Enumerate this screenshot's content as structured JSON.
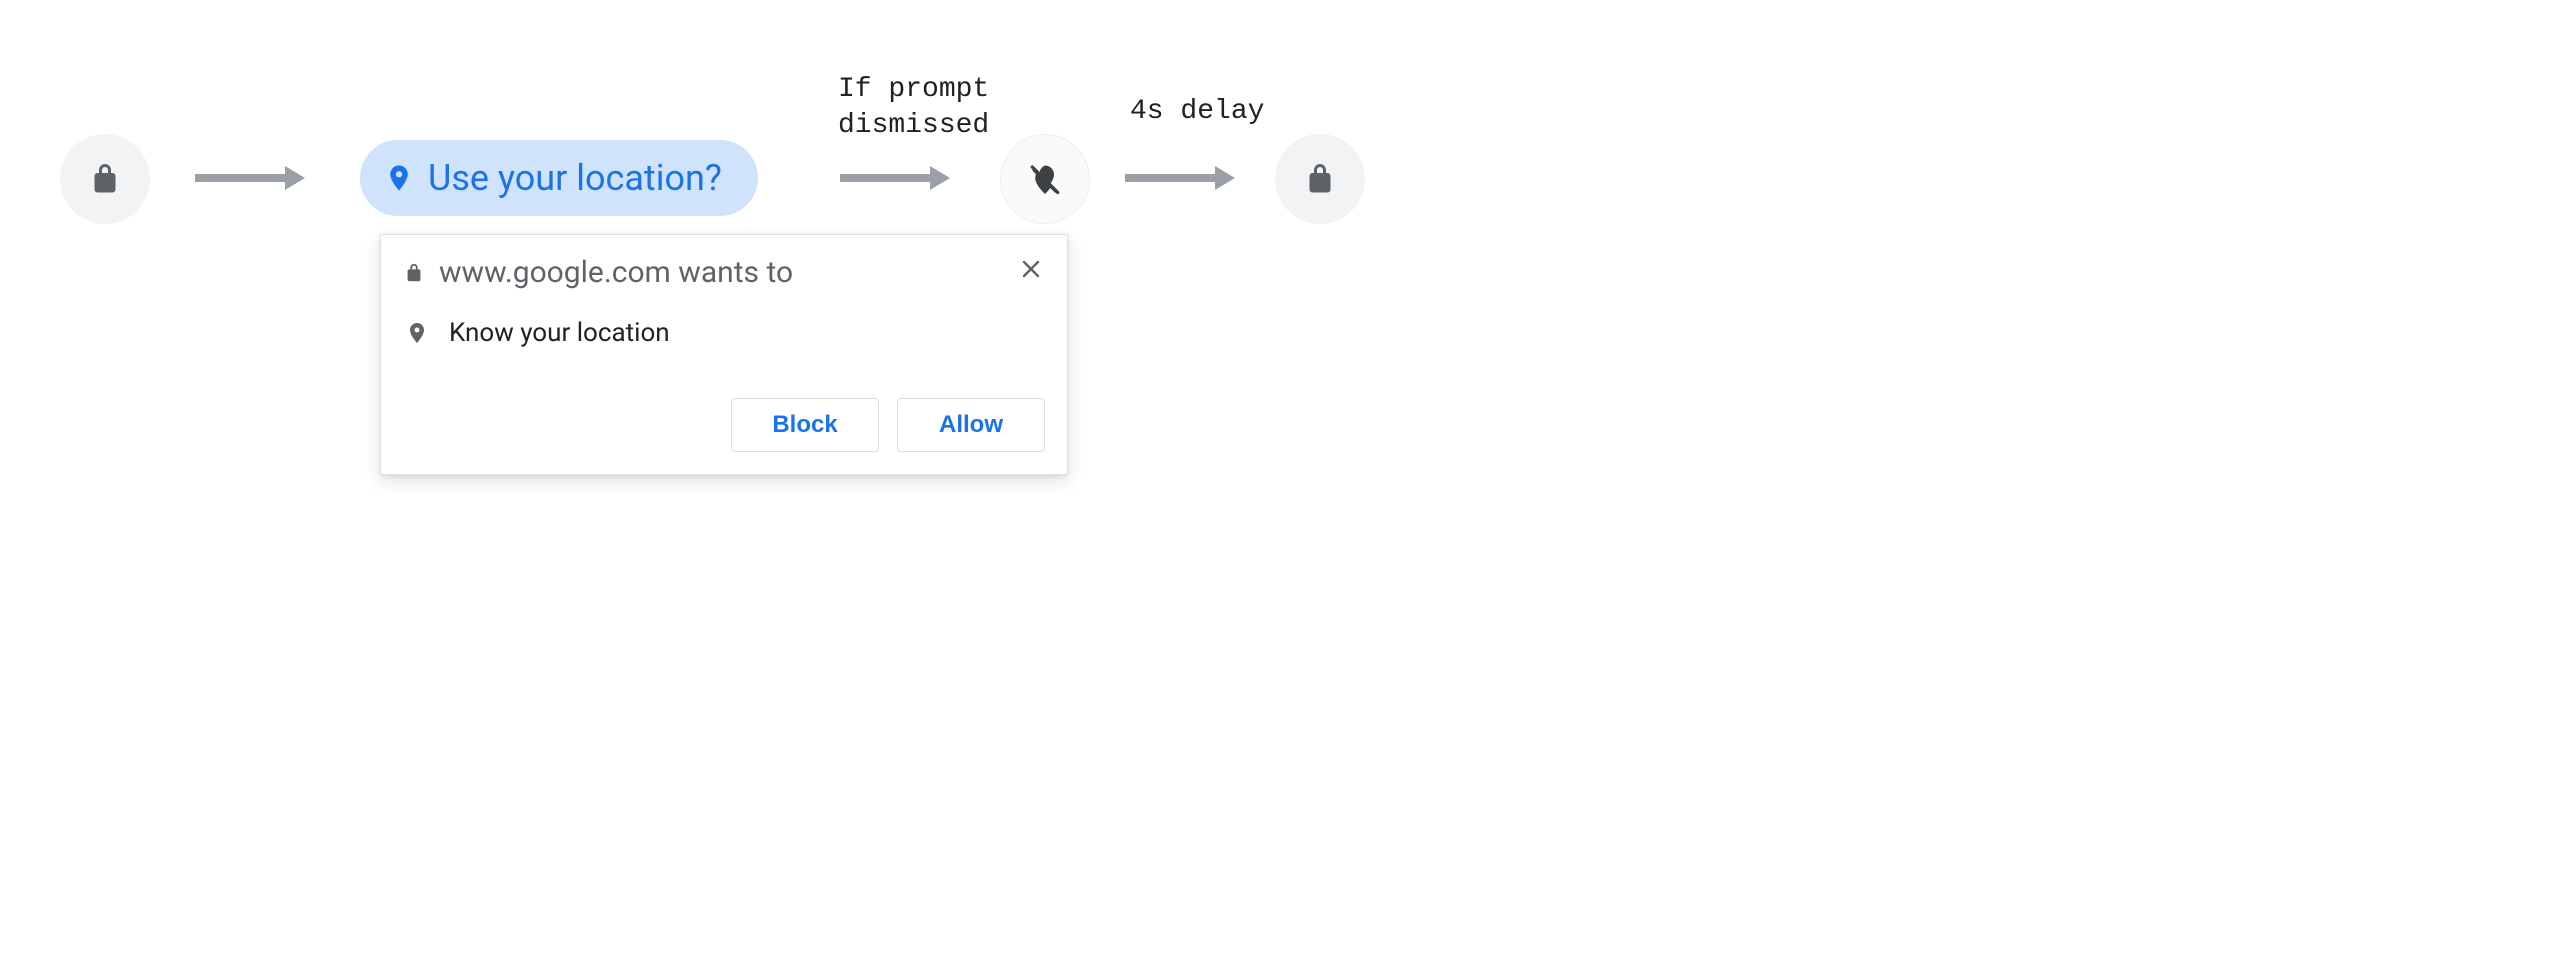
{
  "annotations": {
    "dismissed": "If prompt\ndismissed",
    "delay": "4s delay"
  },
  "chip": {
    "label": "Use your location?"
  },
  "prompt": {
    "title": "www.google.com wants to",
    "permission": "Know your location",
    "block": "Block",
    "allow": "Allow"
  }
}
